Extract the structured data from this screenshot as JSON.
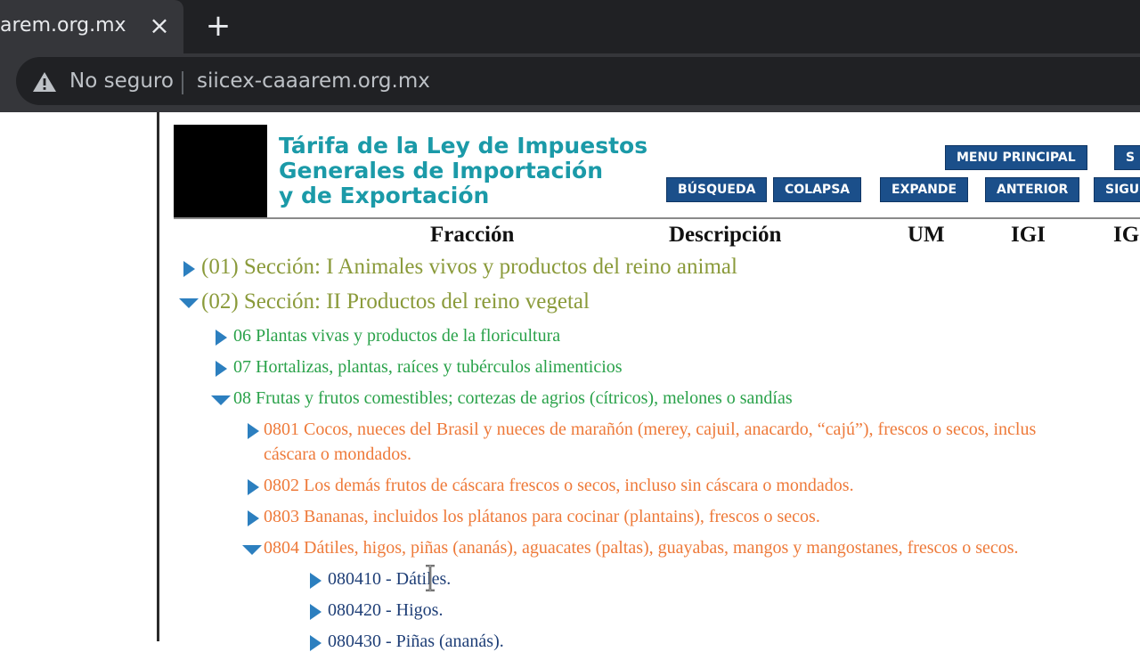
{
  "browser": {
    "tab_title": "arem.org.mx",
    "tab_close": "×",
    "new_tab": "+",
    "security_text": "No seguro",
    "url": "siicex-caaarem.org.mx"
  },
  "header": {
    "title_line1": "Tárifa de la Ley de Impuestos",
    "title_line2": "Generales de Importación",
    "title_line3": "y de Exportación",
    "nav_top": [
      "MENU PRINCIPAL",
      "S"
    ],
    "nav_bottom": [
      "BÚSQUEDA",
      "COLAPSA",
      "EXPANDE",
      "ANTERIOR",
      "SIGU"
    ]
  },
  "columns": [
    "Fracción",
    "Descripción",
    "UM",
    "IGI",
    "IG"
  ],
  "tree": [
    {
      "level": 0,
      "expanded": false,
      "text": "(01) Sección: I Animales vivos y productos del reino animal"
    },
    {
      "level": 0,
      "expanded": true,
      "text": "(02) Sección: II Productos del reino vegetal"
    },
    {
      "level": 1,
      "expanded": false,
      "text": "06 Plantas vivas y productos de la floricultura"
    },
    {
      "level": 1,
      "expanded": false,
      "text": "07 Hortalizas, plantas, raíces y tubérculos alimenticios"
    },
    {
      "level": 1,
      "expanded": true,
      "text": "08 Frutas y frutos comestibles; cortezas de agrios (cítricos), melones o sandías"
    },
    {
      "level": 2,
      "expanded": false,
      "text": "0801 Cocos, nueces del Brasil y nueces de marañón (merey, cajuil, anacardo, “cajú”), frescos o secos, inclus",
      "text2": "cáscara o mondados."
    },
    {
      "level": 2,
      "expanded": false,
      "text": "0802 Los demás frutos de cáscara frescos o secos, incluso sin cáscara o mondados."
    },
    {
      "level": 2,
      "expanded": false,
      "text": "0803 Bananas, incluidos los plátanos para cocinar (plantains), frescos o secos."
    },
    {
      "level": 2,
      "expanded": true,
      "text": "0804 Dátiles, higos, piñas (ananás), aguacates (paltas), guayabas, mangos y mangostanes, frescos o secos."
    },
    {
      "level": 3,
      "expanded": false,
      "text": "080410 - Dátiles."
    },
    {
      "level": 3,
      "expanded": false,
      "text": "080420 - Higos."
    },
    {
      "level": 3,
      "expanded": false,
      "text": "080430 - Piñas (ananás)."
    }
  ],
  "colors": {
    "section": "#8a9a3a",
    "chapter": "#2aa24a",
    "heading": "#ee7a3a",
    "subheading": "#1f3f77",
    "title": "#1b9aa8",
    "nav_button": "#1b4f8a",
    "toggle": "#2c7fbf"
  }
}
